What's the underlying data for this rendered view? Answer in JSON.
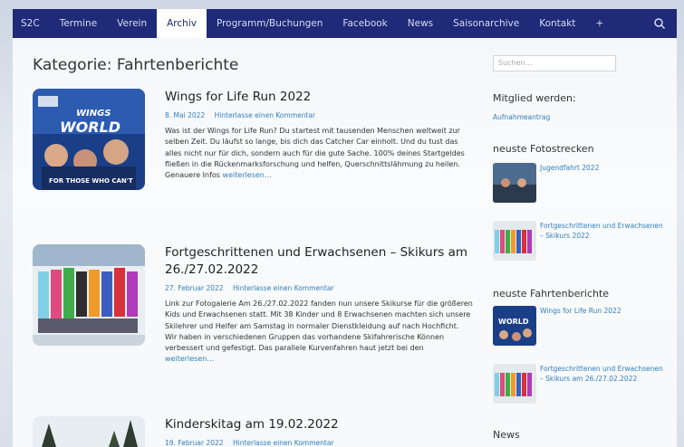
{
  "nav": {
    "items": [
      "S2C",
      "Termine",
      "Verein",
      "Archiv",
      "Programm/Buchungen",
      "Facebook",
      "News",
      "Saisonarchive",
      "Kontakt",
      "+"
    ],
    "active_index": 3,
    "search_icon": "search-icon"
  },
  "page": {
    "title": "Kategorie: Fahrtenberichte"
  },
  "posts": [
    {
      "title": "Wings for Life Run 2022",
      "date": "8. Mai 2022",
      "comment": "Hinterlasse einen Kommentar",
      "excerpt": "Was ist der Wings for Life Run? Du startest mit tausenden Menschen weltweit zur selben Zeit. Du läufst so lange, bis dich das Catcher Car einholt. Und du tust das alles nicht nur für dich, sondern auch für die gute Sache. 100% deines Startgeldes fließen in die Rückenmarksforschung und helfen, Querschnittslähmung zu heilen. Genauere Infos",
      "more": "weiterlesen…"
    },
    {
      "title": "Fortgeschrittenen und Erwachsenen – Skikurs am 26./27.02.2022",
      "date": "27. Februar 2022",
      "comment": "Hinterlasse einen Kommentar",
      "excerpt": "Link zur Fotogalerie Am 26./27.02.2022 fanden nun unsere Skikurse für die größeren Kids und Erwachsenen statt. Mit 38 Kinder und 8 Erwachsenen machten sich unsere Skilehrer und Helfer am Samstag in normaler Dienstkleidung auf nach Hochficht. Wir haben in verschiedenen Gruppen das vorhandene Skifahrerische Können verbessert und gefestigt. Das parallele Kurvenfahren haut jetzt bei den",
      "more": "weiterlesen…"
    },
    {
      "title": "Kinderskitag am 19.02.2022",
      "date": "19. Februar 2022",
      "comment": "Hinterlasse einen Kommentar",
      "excerpt": "",
      "more": ""
    }
  ],
  "sidebar": {
    "search_placeholder": "Suchen…",
    "member": {
      "heading": "Mitglied werden:",
      "link": "Aufnahmeantrag"
    },
    "photos": {
      "heading": "neuste Fotostrecken",
      "items": [
        "Jugendfahrt 2022",
        "Fortgeschrittenen und Erwachsenen – Skikurs 2022"
      ]
    },
    "reports": {
      "heading": "neuste Fahrtenberichte",
      "items": [
        "Wings for Life Run 2022",
        "Fortgeschrittenen und Erwachsenen – Skikurs am 26./27.02.2022"
      ]
    },
    "news": {
      "heading": "News"
    }
  },
  "colors": {
    "nav_bg": "#1f2a78",
    "link": "#2f7fc0"
  }
}
